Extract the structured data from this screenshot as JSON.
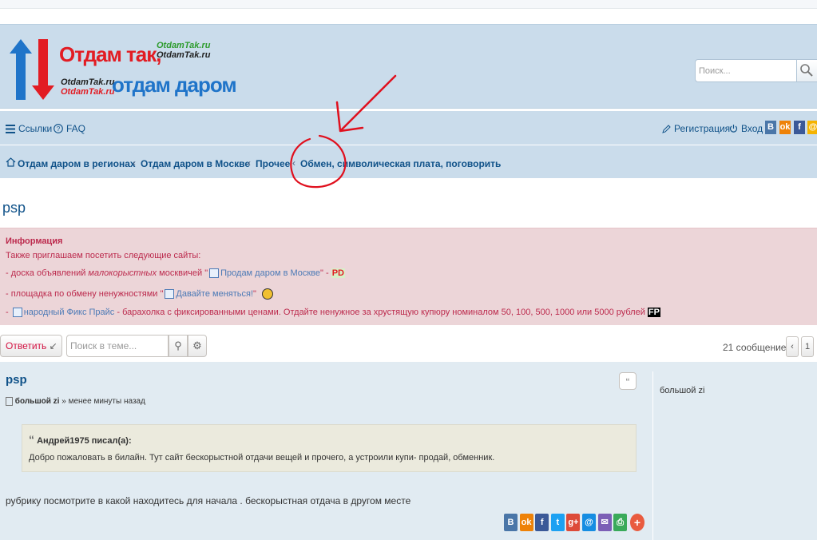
{
  "header": {
    "logo": {
      "line1": "Отдам так,",
      "line2": "отдам даром",
      "domain_small": "OtdamTak.ru"
    },
    "search_placeholder": "Поиск..."
  },
  "nav": {
    "links_label": "Ссылки",
    "faq_label": "FAQ",
    "register_label": "Регистрация",
    "login_label": "Вход",
    "social": [
      {
        "label": "B",
        "color": "#4a76a8"
      },
      {
        "label": "ok",
        "color": "#ee8208"
      },
      {
        "label": "f",
        "color": "#3b5998"
      },
      {
        "label": "@",
        "color": "#f5b300"
      }
    ]
  },
  "breadcrumbs": [
    "Отдам даром в регионах",
    "Отдам даром в Москве",
    "Прочее",
    "Обмен, символическая плата, поговорить"
  ],
  "page_title": "psp",
  "info": {
    "title": "Информация",
    "line1": "Также приглашаем посетить следующие сайты:",
    "line2_a": "- доска объявлений ",
    "line2_b": "малокорыстных",
    "line2_c": " москвичей \"",
    "line2_link": "Продам даром в Москве",
    "line2_d": "\" -",
    "line2_badge": "PD",
    "line3_a": "- площадка по обмену ненужностями \"",
    "line3_link": "Давайте меняться!",
    "line3_b": "\"",
    "line4_a": "- ",
    "line4_link": "народный Фикс Прайс",
    "line4_b": " - барахолка с фиксированными ценами. Отдайте ненужное за хрустящую купюру номиналом 50, 100, 500, 1000 или 5000 рублей",
    "line4_badge": "FP"
  },
  "toolbar": {
    "reply_label": "Ответить",
    "topic_search_placeholder": "Поиск в теме...",
    "post_count": "21 сообщение",
    "page_number": "1"
  },
  "post": {
    "title": "psp",
    "author": "большой zi",
    "time": "» менее минуты назад",
    "quote_author": "Андрей1975 писал(а):",
    "quote_text": "Добро пожаловать в билайн. Тут сайт бескорыстной отдачи вещей и прочего, а устроили купи- продай, обменник.",
    "body": "рубрику посмотрите в какой находитесь для начала . бескорыстная отдача в другом месте",
    "profile_name": "большой zi",
    "share": [
      {
        "label": "B",
        "color": "#4a76a8"
      },
      {
        "label": "ok",
        "color": "#ee8208"
      },
      {
        "label": "f",
        "color": "#3b5998"
      },
      {
        "label": "t",
        "color": "#1da1f2"
      },
      {
        "label": "g+",
        "color": "#dd4b39"
      },
      {
        "label": "@",
        "color": "#168de2"
      },
      {
        "label": "✉",
        "color": "#7c5fb6"
      },
      {
        "label": "⎙",
        "color": "#3aaa5a"
      }
    ]
  }
}
